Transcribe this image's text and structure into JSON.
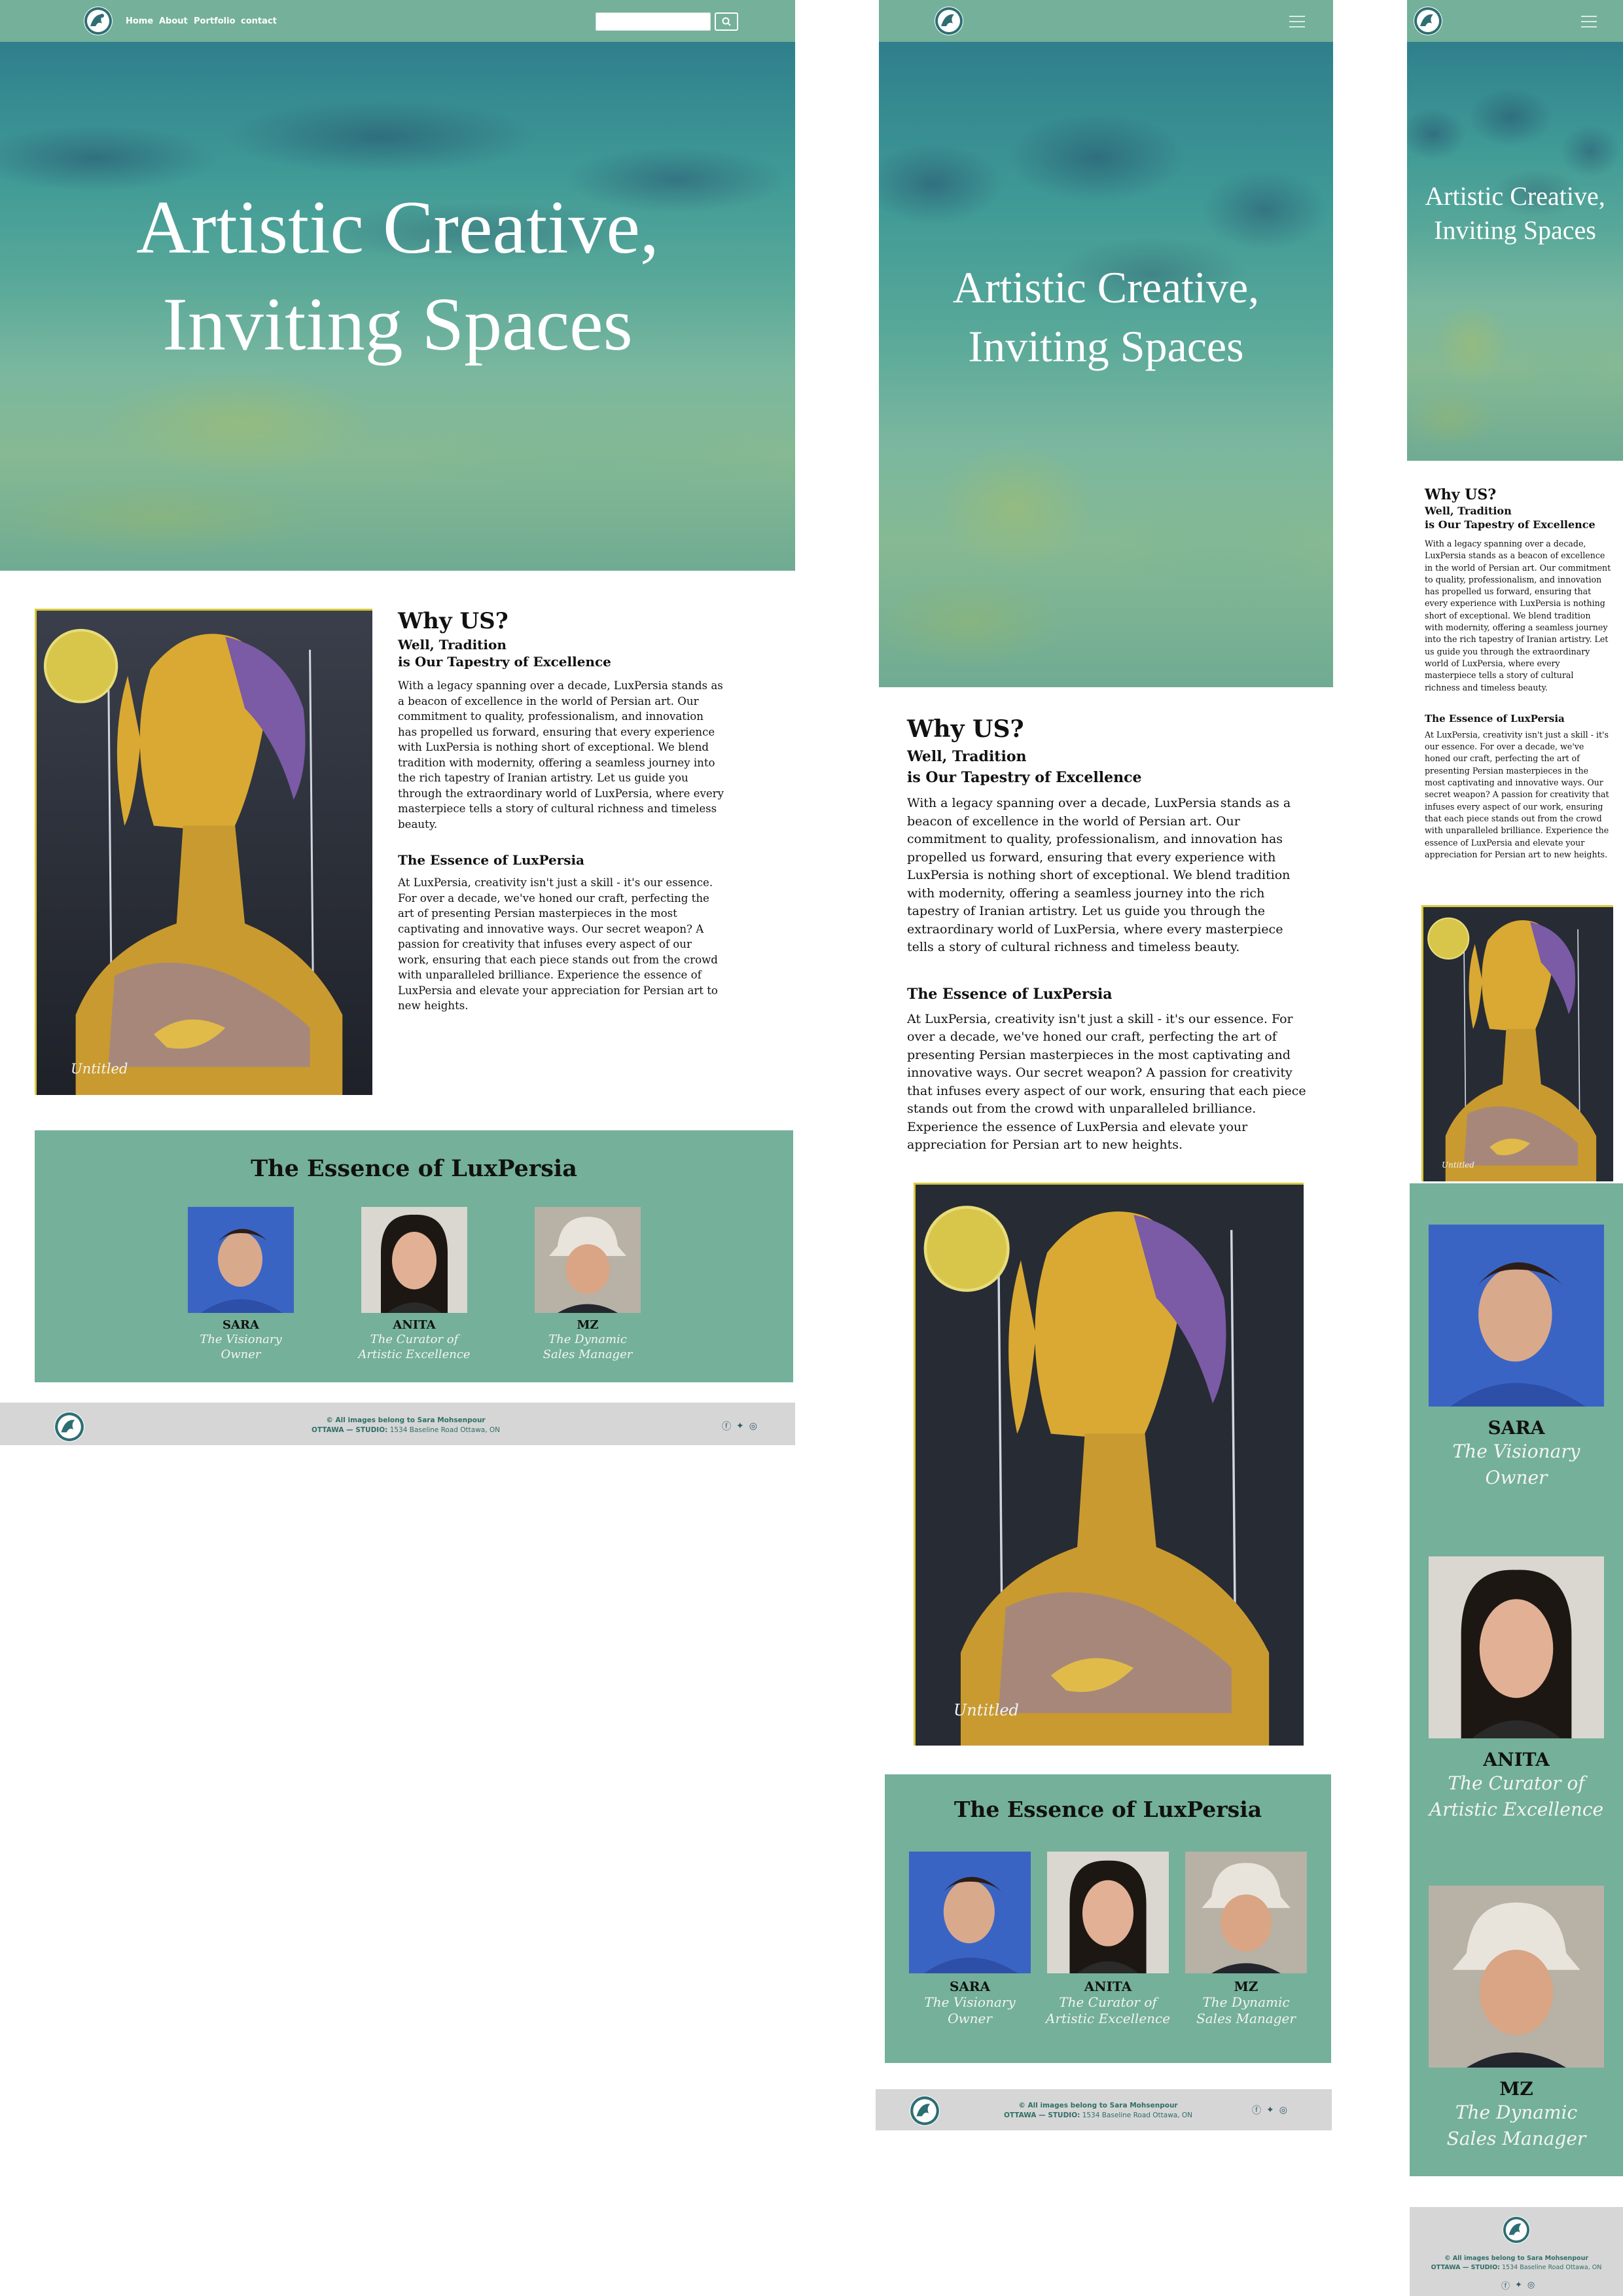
{
  "brand": {
    "logo": "luxpersia-logo-icon"
  },
  "nav": {
    "links": [
      "Home",
      "About",
      "Portfolio",
      "contact"
    ],
    "search_placeholder": "",
    "search_icon": "search-icon",
    "menu_icon": "hamburger-menu-icon"
  },
  "hero": {
    "line1": "Artistic Creative,",
    "line2": "Inviting Spaces"
  },
  "why": {
    "title": "Why US?",
    "subtitle_line1": "Well, Tradition",
    "subtitle_line2": "is Our Tapestry of Excellence",
    "body": "With a legacy spanning over a decade, LuxPersia stands as a beacon of excellence in the world of Persian art. Our commitment to quality, professionalism, and innovation has propelled us forward, ensuring that every experience with LuxPersia is nothing short of exceptional. We blend tradition with modernity, offering a seamless journey into the rich tapestry of Iranian artistry. Let us guide you through the extraordinary world of LuxPersia, where every masterpiece tells a story of cultural richness and timeless beauty."
  },
  "essence": {
    "title": "The Essence of LuxPersia",
    "body": "At LuxPersia, creativity isn't just a skill - it's our essence. For over a decade, we've honed our craft, perfecting the art of presenting Persian masterpieces in the most captivating and innovative ways. Our secret weapon? A passion for creativity that infuses every aspect of our work, ensuring that each piece stands out from the crowd with unparalleled brilliance. Experience the essence of LuxPersia and elevate your appreciation for Persian art to new heights."
  },
  "painting": {
    "caption": "Untitled"
  },
  "team": {
    "title": "The Essence of LuxPersia",
    "members": [
      {
        "name": "SARA",
        "role_line1": "The Visionary",
        "role_line2": "Owner"
      },
      {
        "name": "ANITA",
        "role_line1": "The Curator of",
        "role_line2": "Artistic Excellence"
      },
      {
        "name": "MZ",
        "role_line1": "The Dynamic",
        "role_line2": "Sales Manager"
      }
    ]
  },
  "footer": {
    "copyright": "© All images belong to Sara Mohsenpour",
    "studio_label": "OTTAWA — STUDIO:",
    "address": "1534 Baseline Road Ottawa, ON",
    "social_icons": [
      "facebook-icon",
      "twitter-icon",
      "instagram-icon"
    ]
  },
  "colors": {
    "accent": "#74b09a",
    "footer": "#d6d6d6",
    "text": "#111111",
    "white": "#ffffff"
  }
}
